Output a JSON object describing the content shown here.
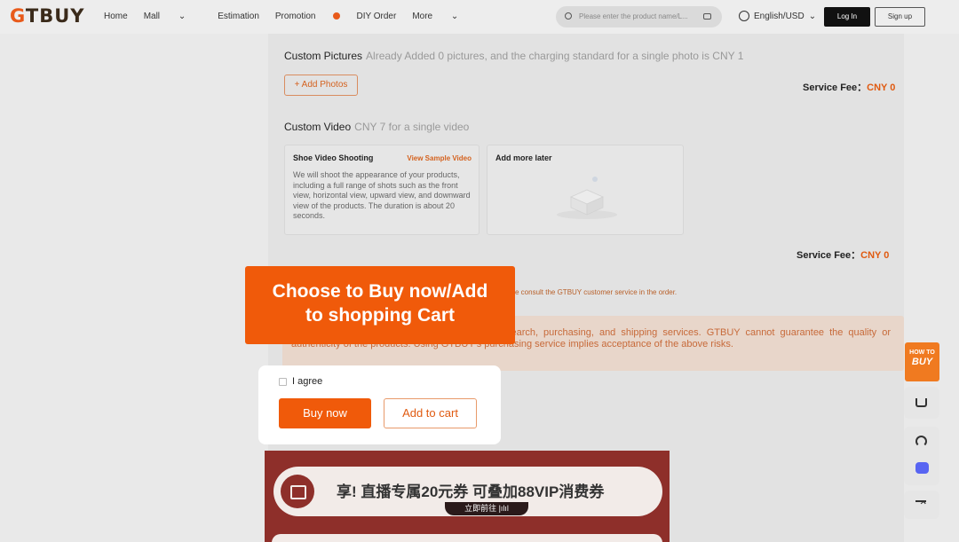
{
  "header": {
    "logo": "GTBUY",
    "nav": {
      "home": "Home",
      "mall": "Mall",
      "estimation": "Estimation",
      "promotion": "Promotion",
      "diy_order": "DIY Order",
      "more": "More"
    },
    "search_placeholder": "Please enter the product name/L...",
    "language": "English/USD",
    "login": "Log In",
    "signup": "Sign up"
  },
  "custom_pictures": {
    "title": "Custom Pictures",
    "subtitle": "Already Added 0 pictures, and the charging standard for a single photo is CNY 1",
    "add_button": "+ Add Photos",
    "fee_label": "Service Fee：",
    "fee_value": "CNY 0"
  },
  "custom_video": {
    "title": "Custom Video",
    "subtitle": "CNY 7 for a single video",
    "card1": {
      "title": "Shoe Video Shooting",
      "link": "View Sample Video",
      "desc": "We will shoot the appearance of your products, including a full range of shots such as the front view, horizontal view, upward view, and downward view of the products. The duration is about 20 seconds."
    },
    "card2": {
      "title": "Add more later"
    },
    "fee_label": "Service Fee：",
    "fee_value": "CNY 0"
  },
  "notice": "e consult the GTBUY customer service in the order.",
  "warning": "r platforms. GTBUY only provides information search, purchasing, and shipping services. GTBUY cannot guarantee the quality or authenticity of the products. Using GTBUY's purchasing service implies acceptance of the above risks.",
  "callout": {
    "line1": "Choose to Buy now/Add",
    "line2": "to shopping Cart"
  },
  "agree": {
    "label": "I agree",
    "buy_now": "Buy now",
    "add_cart": "Add to cart"
  },
  "banner": {
    "text": "享! 直播专属20元券  可叠加88VIP消费券",
    "go": "立即前往  |ılıl"
  },
  "side": {
    "howto_small": "HOW TO",
    "howto_big": "BUY"
  },
  "colors": {
    "accent": "#f05a0a",
    "fee": "#e05a10"
  }
}
